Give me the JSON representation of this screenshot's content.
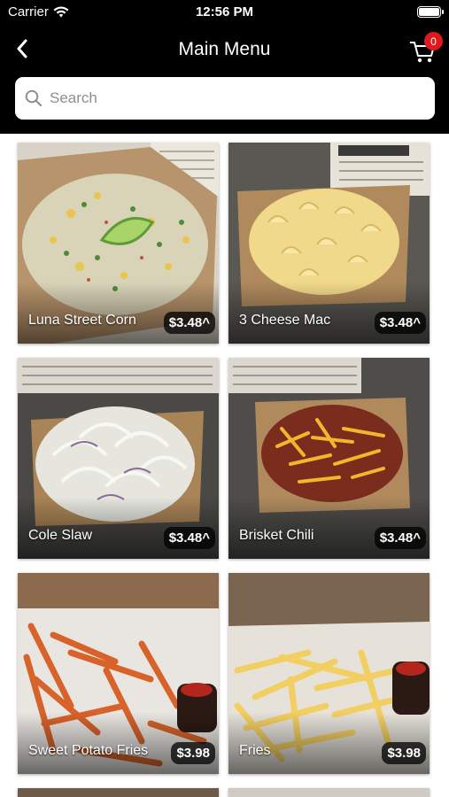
{
  "status": {
    "carrier": "Carrier",
    "time": "12:56 PM"
  },
  "nav": {
    "title": "Main Menu",
    "cart_count": "0"
  },
  "search": {
    "placeholder": "Search"
  },
  "items": [
    {
      "name": "Luna Street Corn",
      "price": "$3.48^"
    },
    {
      "name": "3 Cheese Mac",
      "price": "$3.48^"
    },
    {
      "name": "Cole Slaw",
      "price": "$3.48^"
    },
    {
      "name": "Brisket Chili",
      "price": "$3.48^"
    },
    {
      "name": "Sweet Potato Fries",
      "price": "$3.98"
    },
    {
      "name": "Fries",
      "price": "$3.98"
    }
  ],
  "colors": {
    "header": "#000000",
    "badge": "#e0191e",
    "background": "#ffffff"
  },
  "icons": [
    "wifi-icon",
    "battery-icon",
    "back-chevron-icon",
    "cart-icon",
    "search-icon"
  ]
}
